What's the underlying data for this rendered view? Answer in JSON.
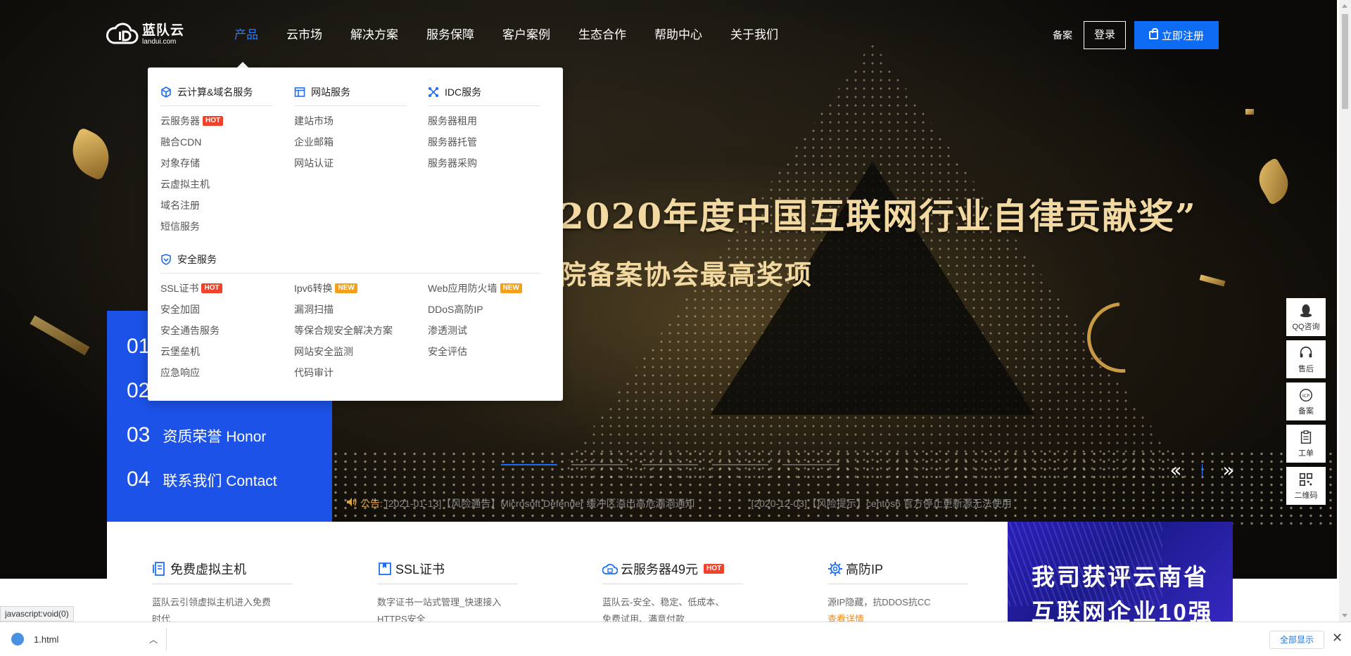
{
  "header": {
    "logo_name": "蓝队云",
    "logo_sub": "landui.com",
    "nav": [
      "产品",
      "云市场",
      "解决方案",
      "服务保障",
      "客户案例",
      "生态合作",
      "帮助中心",
      "关于我们"
    ],
    "beian": "备案",
    "login": "登录",
    "register": "立即注册"
  },
  "dropdown": {
    "cloud": {
      "title": "云计算&域名服务",
      "items": [
        "云服务器",
        "融合CDN",
        "对象存储",
        "云虚拟主机",
        "域名注册",
        "短信服务"
      ],
      "hot_badge": "HOT"
    },
    "website": {
      "title": "网站服务",
      "items": [
        "建站市场",
        "企业邮箱",
        "网站认证"
      ]
    },
    "idc": {
      "title": "IDC服务",
      "items": [
        "服务器租用",
        "服务器托管",
        "服务器采购"
      ]
    },
    "security": {
      "title": "安全服务",
      "col1": [
        "SSL证书",
        "安全加固",
        "安全通告服务",
        "云堡垒机",
        "应急响应"
      ],
      "col2": [
        "Ipv6转换",
        "漏洞扫描",
        "等保合规安全解决方案",
        "网站安全监测",
        "代码审计"
      ],
      "col3": [
        "Web应用防火墙",
        "DDoS高防IP",
        "渗透测试",
        "安全评估"
      ],
      "hot": "HOT",
      "new": "NEW"
    }
  },
  "hero": {
    "title": "2020年度中国互联网行业自律贡献奖”",
    "subtitle": "院备案协会最高奖项"
  },
  "side_tabs": [
    {
      "num": "01",
      "label": ""
    },
    {
      "num": "02",
      "label": ""
    },
    {
      "num": "03",
      "label": "资质荣誉 Honor"
    },
    {
      "num": "04",
      "label": "联系我们 Contact"
    }
  ],
  "slider": {
    "count": 5,
    "active": 0
  },
  "notice": {
    "label": "公告:",
    "items": [
      "[2021-01-13]【风险通告】Microsoft Defender 缓冲区溢出高危漏洞通知",
      "[2020-12-03]【风险提示】centos6 官方停止更新源无法使用"
    ]
  },
  "float_bar": [
    "QQ咨询",
    "售后",
    "备案",
    "工单",
    "二维码"
  ],
  "features": [
    {
      "title": "免费虚拟主机",
      "desc": [
        "蓝队云引领虚拟主机进入免费",
        "时代"
      ],
      "icon": "server-icon"
    },
    {
      "title": "SSL证书",
      "desc": [
        "数字证书一站式管理_快速接入",
        "HTTPS安全"
      ],
      "icon": "bookmark-icon"
    },
    {
      "title": "云服务器49元",
      "badge": "HOT",
      "desc": [
        "蓝队云-安全、稳定、低成本、",
        "免费试用、满意付款"
      ],
      "icon": "cloud-server-icon"
    },
    {
      "title": "高防IP",
      "desc": [
        "源IP隐藏，抗DDOS抗CC"
      ],
      "link": "查看详情",
      "icon": "gear-icon"
    }
  ],
  "promo": {
    "line1": "我司获评云南省",
    "line2": "互联网企业10强"
  },
  "status_url": "javascript:void(0)",
  "download_bar": {
    "file": "1.html",
    "show_all": "全部显示"
  },
  "colors": {
    "brand_blue": "#0d6cf3",
    "side_blue": "#1c52e8",
    "nav_active": "#2d7cf6",
    "hot_red": "#f0432c",
    "new_orange": "#f4a01c",
    "gold": "#f2d9a2"
  }
}
